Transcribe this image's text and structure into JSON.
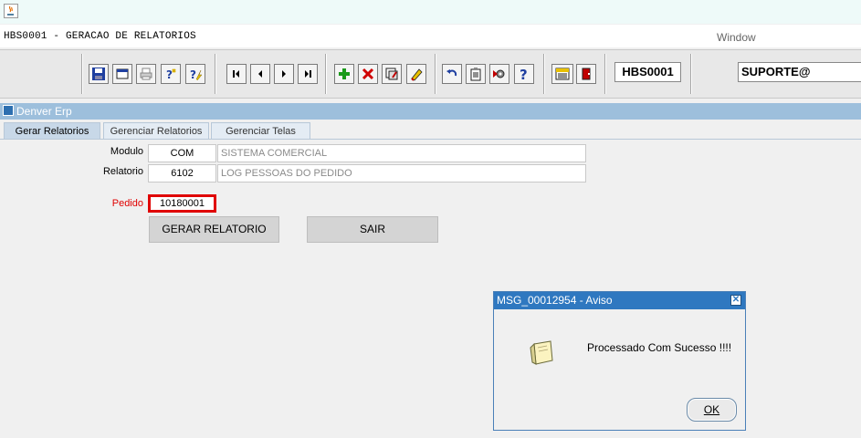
{
  "app": {
    "title": "HBS0001 - GERACAO DE RELATORIOS",
    "window_menu": "Window"
  },
  "toolbar": {
    "buttons": [
      {
        "name": "save-icon"
      },
      {
        "name": "window-icon"
      },
      {
        "name": "print-icon"
      },
      {
        "name": "help-query-icon"
      },
      {
        "name": "execute-query-icon"
      },
      {
        "name": "first-record-icon"
      },
      {
        "name": "previous-record-icon"
      },
      {
        "name": "next-record-icon"
      },
      {
        "name": "last-record-icon"
      },
      {
        "name": "insert-record-icon"
      },
      {
        "name": "delete-record-icon"
      },
      {
        "name": "duplicate-record-icon"
      },
      {
        "name": "edit-record-icon"
      },
      {
        "name": "undo-icon"
      },
      {
        "name": "clipboard-icon"
      },
      {
        "name": "settings-icon"
      },
      {
        "name": "help-icon"
      },
      {
        "name": "menu-icon"
      },
      {
        "name": "exit-icon"
      }
    ],
    "screen_code": "HBS0001",
    "user": "SUPORTE@"
  },
  "inner_window": {
    "title": "Denver Erp"
  },
  "tabs": [
    {
      "label": "Gerar Relatorios",
      "active": true
    },
    {
      "label": "Gerenciar Relatorios",
      "active": false
    },
    {
      "label": "Gerenciar Telas",
      "active": false
    }
  ],
  "form": {
    "modulo_label": "Modulo",
    "modulo_code": "COM",
    "modulo_desc": "SISTEMA COMERCIAL",
    "relatorio_label": "Relatorio",
    "relatorio_code": "6102",
    "relatorio_desc": "LOG PESSOAS DO PEDIDO",
    "pedido_label": "Pedido",
    "pedido_value": "10180001",
    "generate_label": "GERAR RELATORIO",
    "exit_label": "SAIR"
  },
  "dialog": {
    "title": "MSG_00012954 - Aviso",
    "message": "Processado Com Sucesso !!!!",
    "ok_label": "OK"
  },
  "colors": {
    "highlight": "#e00000",
    "dialog_title": "#2f78c0",
    "inner_header": "#9dbfdc"
  }
}
